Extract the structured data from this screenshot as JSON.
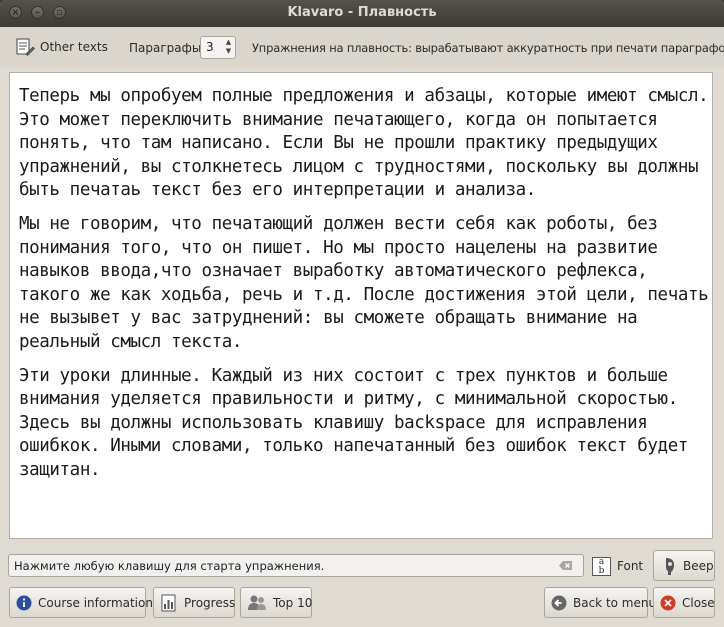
{
  "window": {
    "title": "Klavaro - Плавность",
    "controls": [
      "close-icon",
      "minimize-icon",
      "maximize-icon"
    ]
  },
  "toolbar": {
    "other_texts_label": "Other texts",
    "paragraphs_label": "Параграфы:",
    "paragraphs_value": "3",
    "description": "Упражнения на плавность: вырабатывают аккуратность при печати параграфов."
  },
  "text": {
    "paragraphs": [
      "Теперь мы опробуем полные предложения и абзацы, которые имеют смысл. Это может переключить внимание печатающего, когда он попытается понять, что там написано. Если Вы не прошли практику предыдущих упражнений, вы столкнетесь лицом с трудностями, поскольку вы должны быть печатаь текст без его интерпретации и анализа.",
      "Мы не говорим, что печатающий должен вести себя как роботы, без понимания того, что он пишет. Но мы просто нацелены на развитие навыков ввода,что означает выработку автоматического рефлекса, такого же как ходьба, речь и т.д. После достижения этой цели, печать не вызывет у вас затруднений: вы сможете обращать внимание на реальный смысл текста.",
      "Эти уроки длинные. Каждый из них состоит с трех пунктов и больше внимания уделяется правильности и ритму, с минимальной скоростью. Здесь вы должны использовать клавишу backspace для исправления ошибкок. Иными словами, только напечатанный без ошибок текст будет защитан."
    ]
  },
  "input": {
    "value": "Нажмите любую клавишу для старта упражнения."
  },
  "font_button": {
    "label": "Font"
  },
  "beep_button": {
    "label": "Beep"
  },
  "bottom_buttons": {
    "course_information": "Course information",
    "progress": "Progress",
    "top10": "Top 10",
    "back_to_menu": "Back to menu",
    "close": "Close"
  },
  "colors": {
    "title_bar": "#3d3b36",
    "window_bg": "#dfdbd2",
    "close_red": "#d63a1f",
    "info_blue": "#2a4ea3"
  }
}
